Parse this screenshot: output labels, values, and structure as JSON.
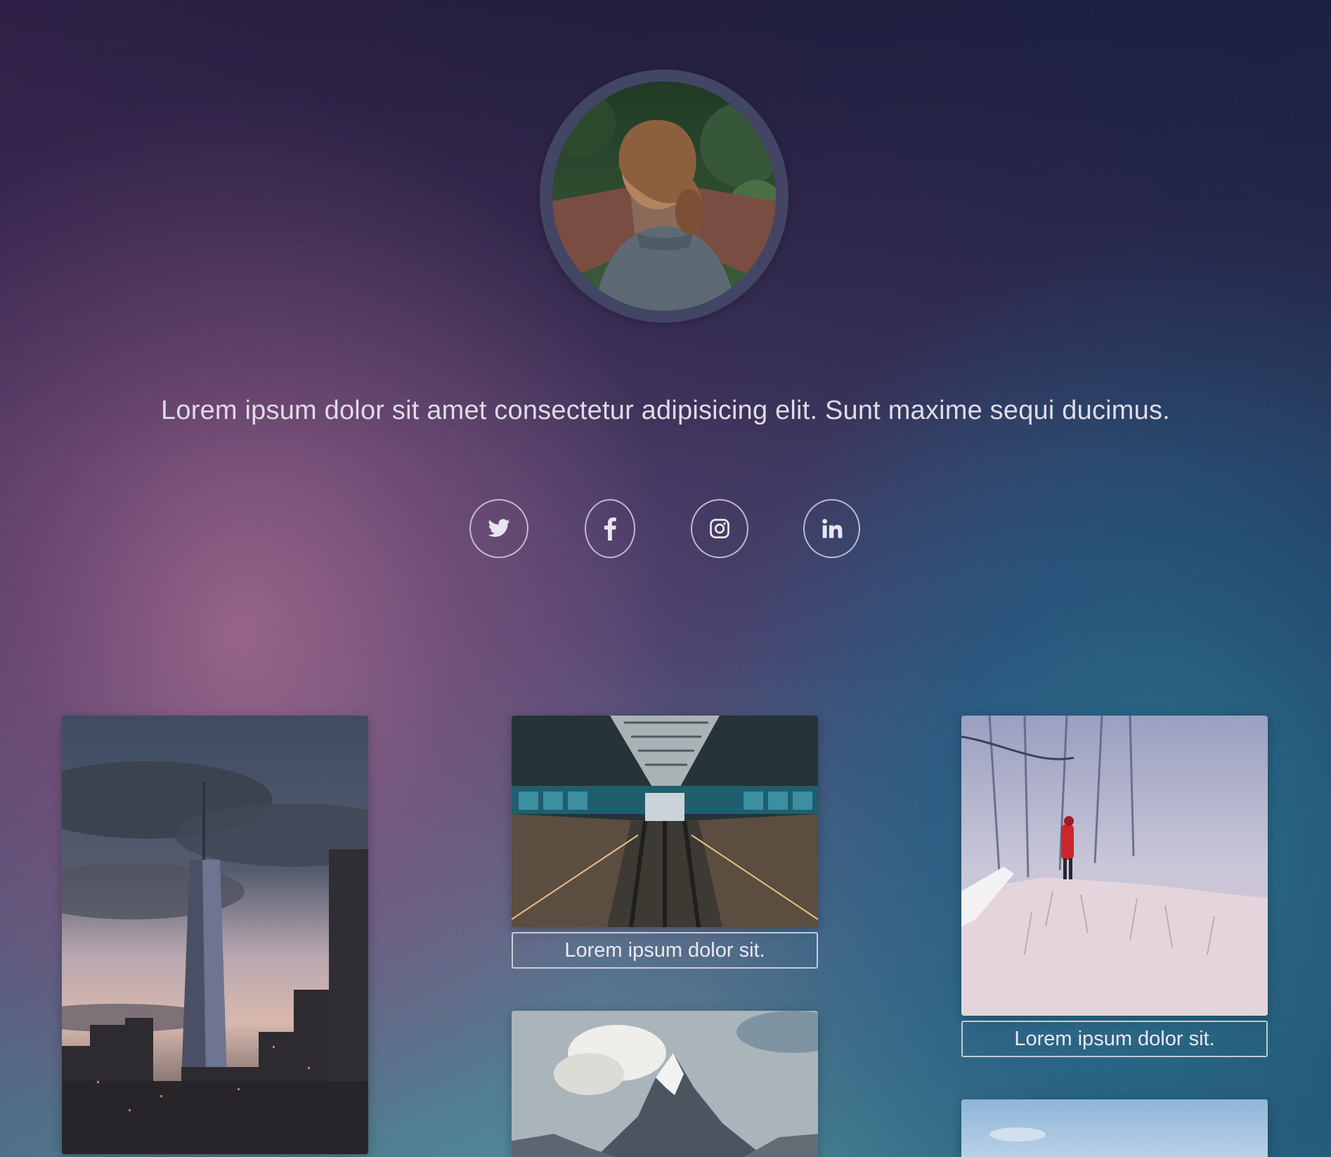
{
  "profile": {
    "avatar_alt": "",
    "tagline": "Lorem ipsum dolor sit amet consectetur adipisicing elit. Sunt maxime sequi ducimus."
  },
  "social": [
    {
      "name": "twitter",
      "icon": "twitter-icon"
    },
    {
      "name": "facebook",
      "icon": "facebook-icon"
    },
    {
      "name": "instagram",
      "icon": "instagram-icon"
    },
    {
      "name": "linkedin",
      "icon": "linkedin-icon"
    }
  ],
  "gallery": {
    "items": [
      {
        "subject": "city skyline at dusk",
        "caption": ""
      },
      {
        "subject": "escalator hall",
        "caption": "Lorem ipsum dolor sit."
      },
      {
        "subject": "snowy forest with person in red coat",
        "caption": "Lorem ipsum dolor sit."
      },
      {
        "subject": "snowy mountain peak",
        "caption": ""
      },
      {
        "subject": "blue sky",
        "caption": ""
      }
    ]
  },
  "colors": {
    "text": "#e9e6ef",
    "ring": "#434565",
    "accent_red": "#c9272d"
  }
}
